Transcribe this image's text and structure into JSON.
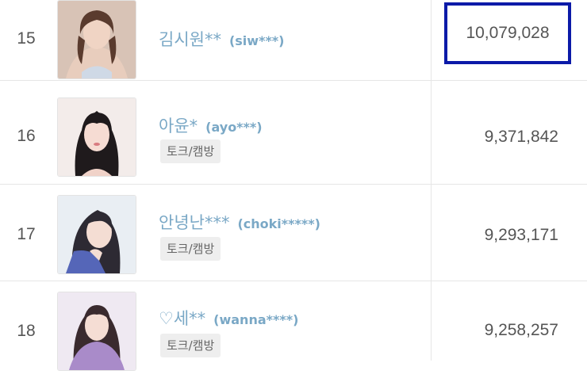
{
  "rows": [
    {
      "rank": "15",
      "name": "김시원**",
      "user_id": "(siw***)",
      "value": "10,079,028",
      "highlighted": true
    },
    {
      "rank": "16",
      "name": "아윤*",
      "user_id": "(ayo***)",
      "tag": "토크/캠방",
      "value": "9,371,842"
    },
    {
      "rank": "17",
      "name": "안녕난***",
      "user_id": "(choki*****)",
      "tag": "토크/캠방",
      "value": "9,293,171"
    },
    {
      "rank": "18",
      "name": "♡세**",
      "user_id": "(wanna****)",
      "tag": "토크/캠방",
      "value": "9,258,257"
    }
  ],
  "colors": {
    "name_link": "#7aa8c6",
    "highlight_border": "#0b1aa8",
    "divider": "#e6e6e6",
    "tag_bg": "#eeeeee"
  }
}
